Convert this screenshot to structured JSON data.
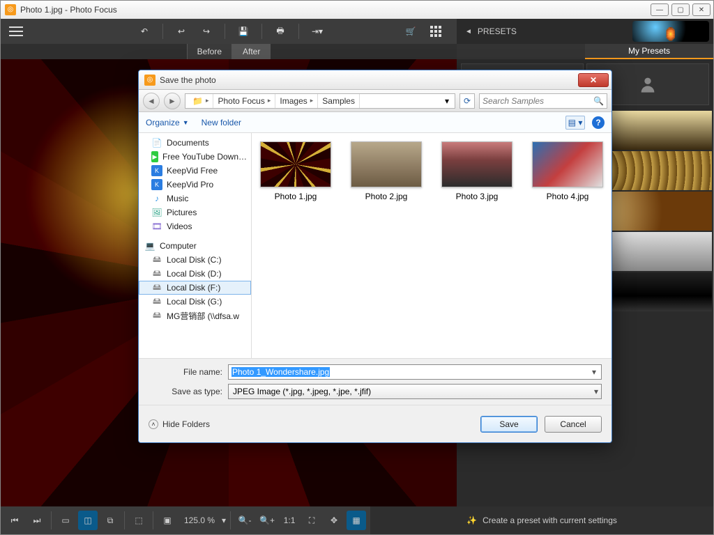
{
  "window": {
    "title": "Photo 1.jpg - Photo Focus"
  },
  "tabs": {
    "before": "Before",
    "after": "After"
  },
  "presets": {
    "header": "PRESETS",
    "my_presets_tab": "My Presets"
  },
  "bottom": {
    "zoom": "125.0 %",
    "create_preset": "Create a preset with current settings"
  },
  "dialog": {
    "title": "Save the photo",
    "breadcrumb": [
      "Photo Focus",
      "Images",
      "Samples"
    ],
    "search_placeholder": "Search Samples",
    "organize": "Organize",
    "new_folder": "New folder",
    "tree": {
      "documents": "Documents",
      "youtube": "Free YouTube Down…",
      "keepvid_free": "KeepVid Free",
      "keepvid_pro": "KeepVid Pro",
      "music": "Music",
      "pictures": "Pictures",
      "videos": "Videos",
      "computer": "Computer",
      "disk_c": "Local Disk (C:)",
      "disk_d": "Local Disk (D:)",
      "disk_f": "Local Disk (F:)",
      "disk_g": "Local Disk (G:)",
      "disk_mg": "MG营销部 (\\\\dfsa.w"
    },
    "files": [
      "Photo 1.jpg",
      "Photo 2.jpg",
      "Photo 3.jpg",
      "Photo 4.jpg"
    ],
    "filename_label": "File name:",
    "filename_value": "Photo 1_Wondershare.jpg",
    "type_label": "Save as type:",
    "type_value": "JPEG Image (*.jpg, *.jpeg, *.jpe, *.jfif)",
    "hide_folders": "Hide Folders",
    "save": "Save",
    "cancel": "Cancel"
  }
}
